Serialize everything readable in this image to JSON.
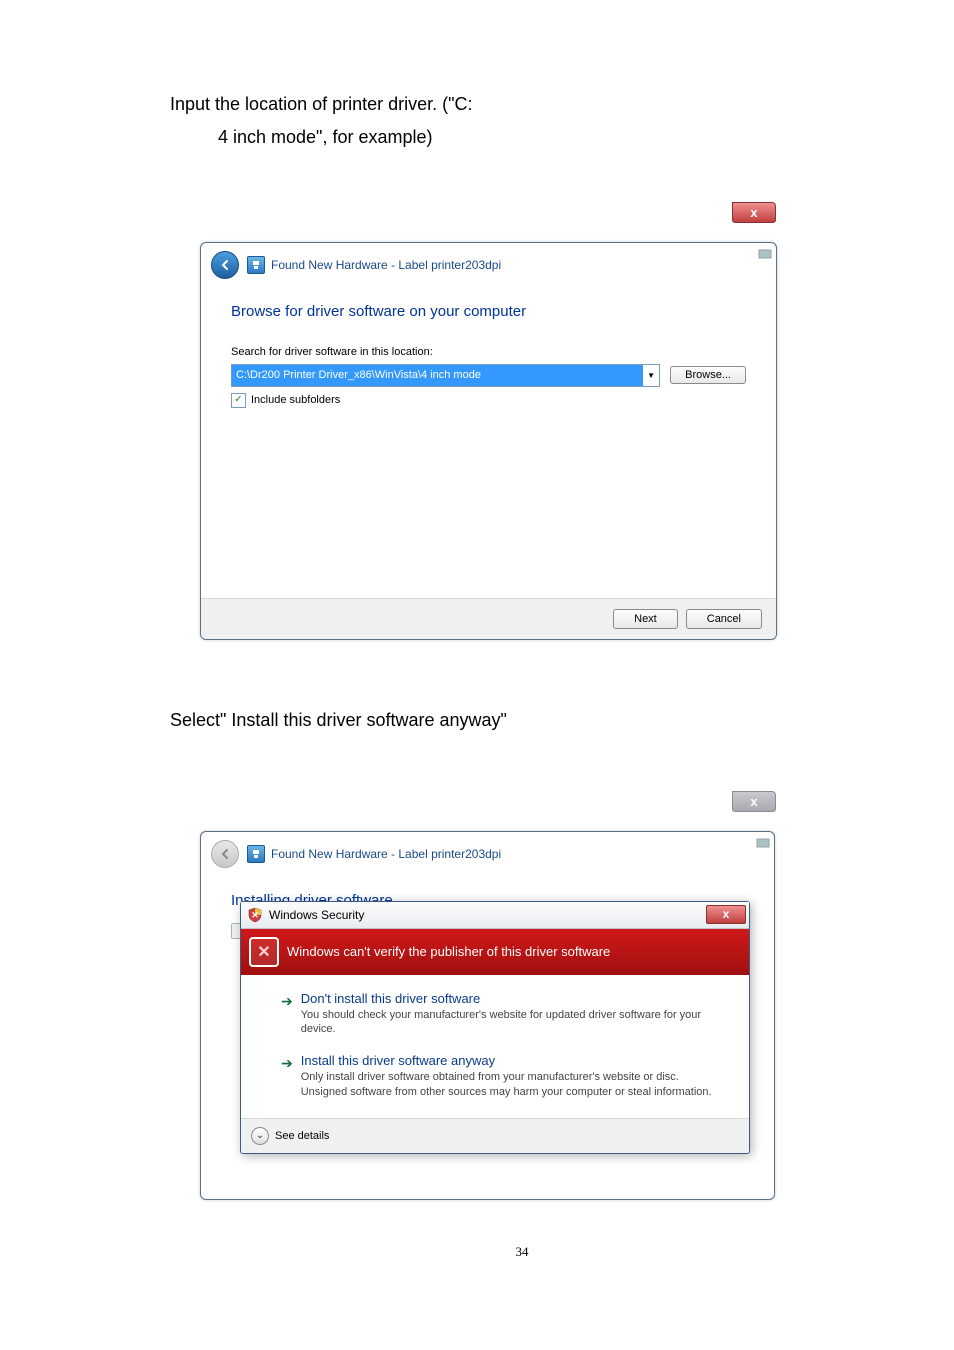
{
  "intro": {
    "line1": "Input the location of printer driver. (\"C:",
    "line2": "4 inch mode\", for example)"
  },
  "dialog1": {
    "title": "Found New Hardware - Label printer203dpi",
    "heading": "Browse for driver software on your computer",
    "search_label": "Search for driver software in this location:",
    "path_value": "C:\\Dr200 Printer Driver_x86\\WinVista\\4 inch mode",
    "browse_label": "Browse...",
    "include_label": "Include subfolders",
    "next_label": "Next",
    "cancel_label": "Cancel",
    "close_glyph": "x"
  },
  "mid_text": "Select\" Install this driver software anyway\"",
  "dialog2": {
    "title": "Found New Hardware - Label printer203dpi",
    "heading": "Installing driver software...",
    "close_glyph": "x"
  },
  "security": {
    "title": "Windows Security",
    "banner": "Windows can't verify the publisher of this driver software",
    "close_glyph": "x",
    "opt1_title": "Don't install this driver software",
    "opt1_desc": "You should check your manufacturer's website for updated driver software for your device.",
    "opt2_title": "Install this driver software anyway",
    "opt2_desc": "Only install driver software obtained from your manufacturer's website or disc. Unsigned software from other sources may harm your computer or steal information.",
    "see_details": "See details"
  },
  "page_number": "34"
}
